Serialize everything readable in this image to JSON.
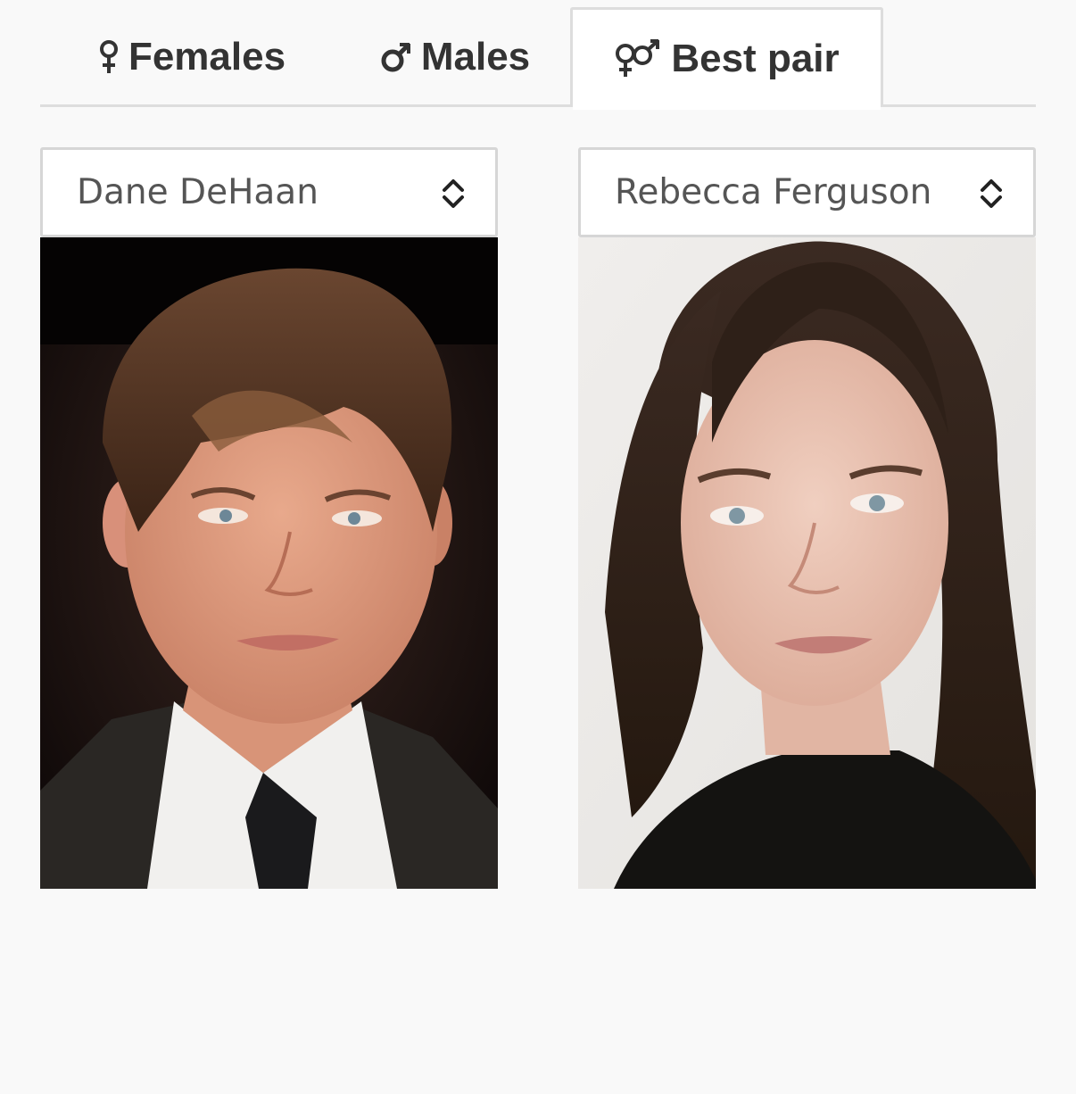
{
  "tabs": [
    {
      "label": "Females",
      "icon": "female-symbol-icon",
      "active": false
    },
    {
      "label": "Males",
      "icon": "male-symbol-icon",
      "active": false
    },
    {
      "label": "Best pair",
      "icon": "pair-symbol-icon",
      "active": true
    }
  ],
  "left": {
    "selected": "Dane DeHaan",
    "photo_icon": "male-portrait-photo"
  },
  "right": {
    "selected": "Rebecca Ferguson",
    "photo_icon": "female-portrait-photo"
  },
  "colors": {
    "background": "#f9f9f9",
    "tab_text": "#333333",
    "border": "#dddddd",
    "select_text": "#555555"
  }
}
